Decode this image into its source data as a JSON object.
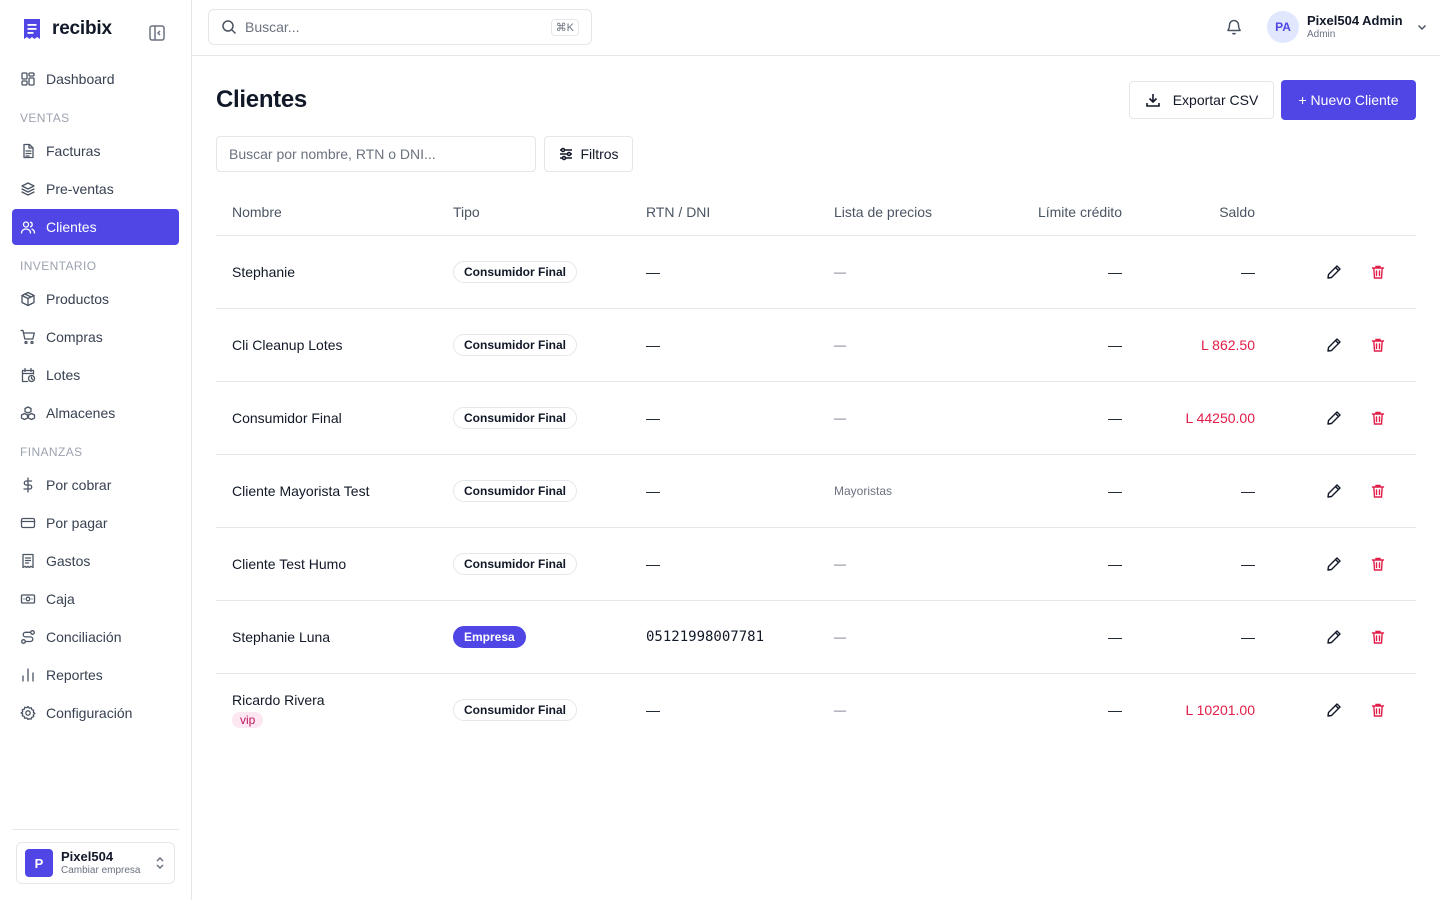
{
  "brand": {
    "name": "recibix"
  },
  "sidebar": {
    "items_top": [
      {
        "label": "Dashboard",
        "icon": "dashboard-icon"
      }
    ],
    "sections": [
      {
        "title": "VENTAS",
        "items": [
          {
            "label": "Facturas",
            "icon": "file-text-icon"
          },
          {
            "label": "Pre-ventas",
            "icon": "layers-icon"
          },
          {
            "label": "Clientes",
            "icon": "users-icon",
            "active": true
          }
        ]
      },
      {
        "title": "INVENTARIO",
        "items": [
          {
            "label": "Productos",
            "icon": "package-icon"
          },
          {
            "label": "Compras",
            "icon": "cart-icon"
          },
          {
            "label": "Lotes",
            "icon": "calendar-clock-icon"
          },
          {
            "label": "Almacenes",
            "icon": "boxes-icon"
          }
        ]
      },
      {
        "title": "FINANZAS",
        "items": [
          {
            "label": "Por cobrar",
            "icon": "dollar-icon"
          },
          {
            "label": "Por pagar",
            "icon": "credit-card-icon"
          },
          {
            "label": "Gastos",
            "icon": "receipt-icon"
          },
          {
            "label": "Caja",
            "icon": "banknote-icon"
          },
          {
            "label": "Conciliación",
            "icon": "route-icon"
          },
          {
            "label": "Reportes",
            "icon": "bar-chart-icon"
          },
          {
            "label": "Configuración",
            "icon": "settings-icon"
          }
        ]
      }
    ],
    "company": {
      "initial": "P",
      "name": "Pixel504",
      "sub": "Cambiar empresa"
    }
  },
  "topbar": {
    "search_placeholder": "Buscar...",
    "shortcut": "⌘K",
    "user": {
      "initials": "PA",
      "name": "Pixel504 Admin",
      "role": "Admin"
    }
  },
  "page": {
    "title": "Clientes",
    "export_label": "Exportar CSV",
    "new_label": "+ Nuevo Cliente",
    "filter_placeholder": "Buscar por nombre, RTN o DNI...",
    "filters_label": "Filtros"
  },
  "table": {
    "columns": [
      "Nombre",
      "Tipo",
      "RTN / DNI",
      "Lista de precios",
      "Límite crédito",
      "Saldo"
    ],
    "rows": [
      {
        "nombre": "Stephanie",
        "tag": "",
        "tipo": "Consumidor Final",
        "tipo_style": "outline",
        "rtn": "—",
        "lista": "—",
        "limite": "—",
        "saldo": "—",
        "saldo_due": false
      },
      {
        "nombre": "Cli Cleanup Lotes",
        "tag": "",
        "tipo": "Consumidor Final",
        "tipo_style": "outline",
        "rtn": "—",
        "lista": "—",
        "limite": "—",
        "saldo": "L 862.50",
        "saldo_due": true
      },
      {
        "nombre": "Consumidor Final",
        "tag": "",
        "tipo": "Consumidor Final",
        "tipo_style": "outline",
        "rtn": "—",
        "lista": "—",
        "limite": "—",
        "saldo": "L 44250.00",
        "saldo_due": true
      },
      {
        "nombre": "Cliente Mayorista Test",
        "tag": "",
        "tipo": "Consumidor Final",
        "tipo_style": "outline",
        "rtn": "—",
        "lista": "Mayoristas",
        "limite": "—",
        "saldo": "—",
        "saldo_due": false
      },
      {
        "nombre": "Cliente Test Humo",
        "tag": "",
        "tipo": "Consumidor Final",
        "tipo_style": "outline",
        "rtn": "—",
        "lista": "—",
        "limite": "—",
        "saldo": "—",
        "saldo_due": false
      },
      {
        "nombre": "Stephanie Luna",
        "tag": "",
        "tipo": "Empresa",
        "tipo_style": "filled",
        "rtn": "05121998007781",
        "rtn_mono": true,
        "lista": "—",
        "limite": "—",
        "saldo": "—",
        "saldo_due": false
      },
      {
        "nombre": "Ricardo Rivera",
        "tag": "vip",
        "tipo": "Consumidor Final",
        "tipo_style": "outline",
        "rtn": "—",
        "lista": "—",
        "limite": "—",
        "saldo": "L 10201.00",
        "saldo_due": true
      }
    ]
  },
  "colors": {
    "accent": "#4f46e5",
    "danger": "#e11d48",
    "border": "#e5e7eb",
    "muted": "#6b7280"
  }
}
